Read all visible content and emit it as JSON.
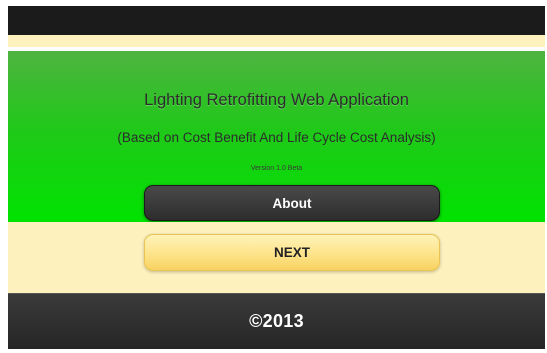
{
  "header": {
    "title": "Lighting Retrofitting Web Application",
    "subtitle": "(Based on Cost Benefit And Life Cycle Cost Analysis)",
    "version": "Version 1.0 Beta"
  },
  "buttons": {
    "about_label": "About",
    "next_label": "NEXT"
  },
  "footer": {
    "copyright": "©2013"
  },
  "colors": {
    "hero_green": "#21c81a",
    "cream": "#fdf1be",
    "dark": "#262626",
    "next_yellow": "#fde38a"
  }
}
